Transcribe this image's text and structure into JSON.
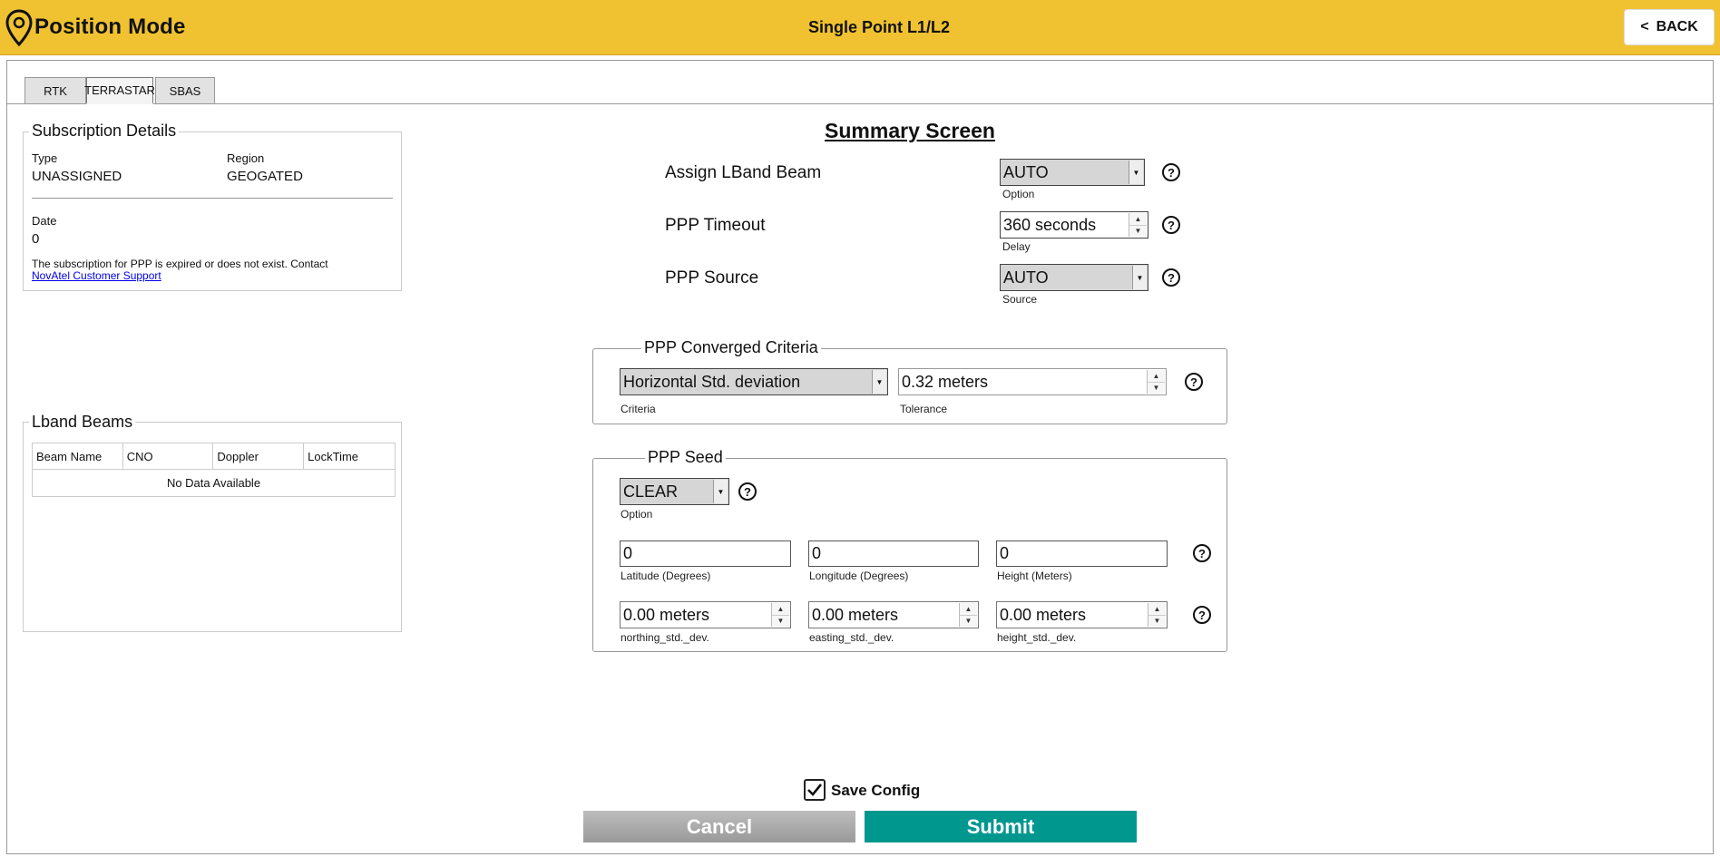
{
  "header": {
    "app_title": "Position Mode",
    "mode_title": "Single Point L1/L2",
    "back_label": "BACK",
    "back_arrow": "<"
  },
  "tabs": [
    {
      "label": "RTK",
      "active": false
    },
    {
      "label": "TERRASTAR",
      "active": true
    },
    {
      "label": "SBAS",
      "active": false
    }
  ],
  "subscription": {
    "title": "Subscription Details",
    "type_label": "Type",
    "type_value": "UNASSIGNED",
    "region_label": "Region",
    "region_value": "GEOGATED",
    "date_label": "Date",
    "date_value": "0",
    "note": "The subscription for PPP is expired or does not exist. Contact",
    "link": "NovAtel Customer Support"
  },
  "lband": {
    "title": "Lband Beams",
    "columns": [
      "Beam Name",
      "CNO",
      "Doppler",
      "LockTime"
    ],
    "empty_text": "No Data Available"
  },
  "summary": {
    "title": "Summary Screen",
    "assign_lband": {
      "label": "Assign LBand Beam",
      "value": "AUTO",
      "sublabel": "Option"
    },
    "ppp_timeout": {
      "label": "PPP Timeout",
      "value": "360 seconds",
      "sublabel": "Delay"
    },
    "ppp_source": {
      "label": "PPP Source",
      "value": "AUTO",
      "sublabel": "Source"
    }
  },
  "converged": {
    "title": "PPP Converged Criteria",
    "criteria_value": "Horizontal Std. deviation",
    "criteria_label": "Criteria",
    "tolerance_value": "0.32 meters",
    "tolerance_label": "Tolerance"
  },
  "seed": {
    "title": "PPP Seed",
    "option_value": "CLEAR",
    "option_label": "Option",
    "latitude_value": "0",
    "latitude_label": "Latitude (Degrees)",
    "longitude_value": "0",
    "longitude_label": "Longitude (Degrees)",
    "height_value": "0",
    "height_label": "Height (Meters)",
    "northing_value": "0.00 meters",
    "northing_label": "northing_std._dev.",
    "easting_value": "0.00 meters",
    "easting_label": "easting_std._dev.",
    "height_std_value": "0.00 meters",
    "height_std_label": "height_std._dev."
  },
  "footer": {
    "save_config_label": "Save Config",
    "save_config_checked": true,
    "cancel_label": "Cancel",
    "submit_label": "Submit"
  },
  "help_glyph": "?",
  "colors": {
    "header_bg": "#f0c232",
    "submit_bg": "#00978f",
    "cancel_bg": "#a8a8a8",
    "link": "#0000ee"
  },
  "icons": {
    "logo": "map-pin-icon",
    "help": "help-circle-icon",
    "dropdown": "dropdown-arrow-icon",
    "spin": "spinner-arrows-icon",
    "check": "checkmark-icon"
  }
}
